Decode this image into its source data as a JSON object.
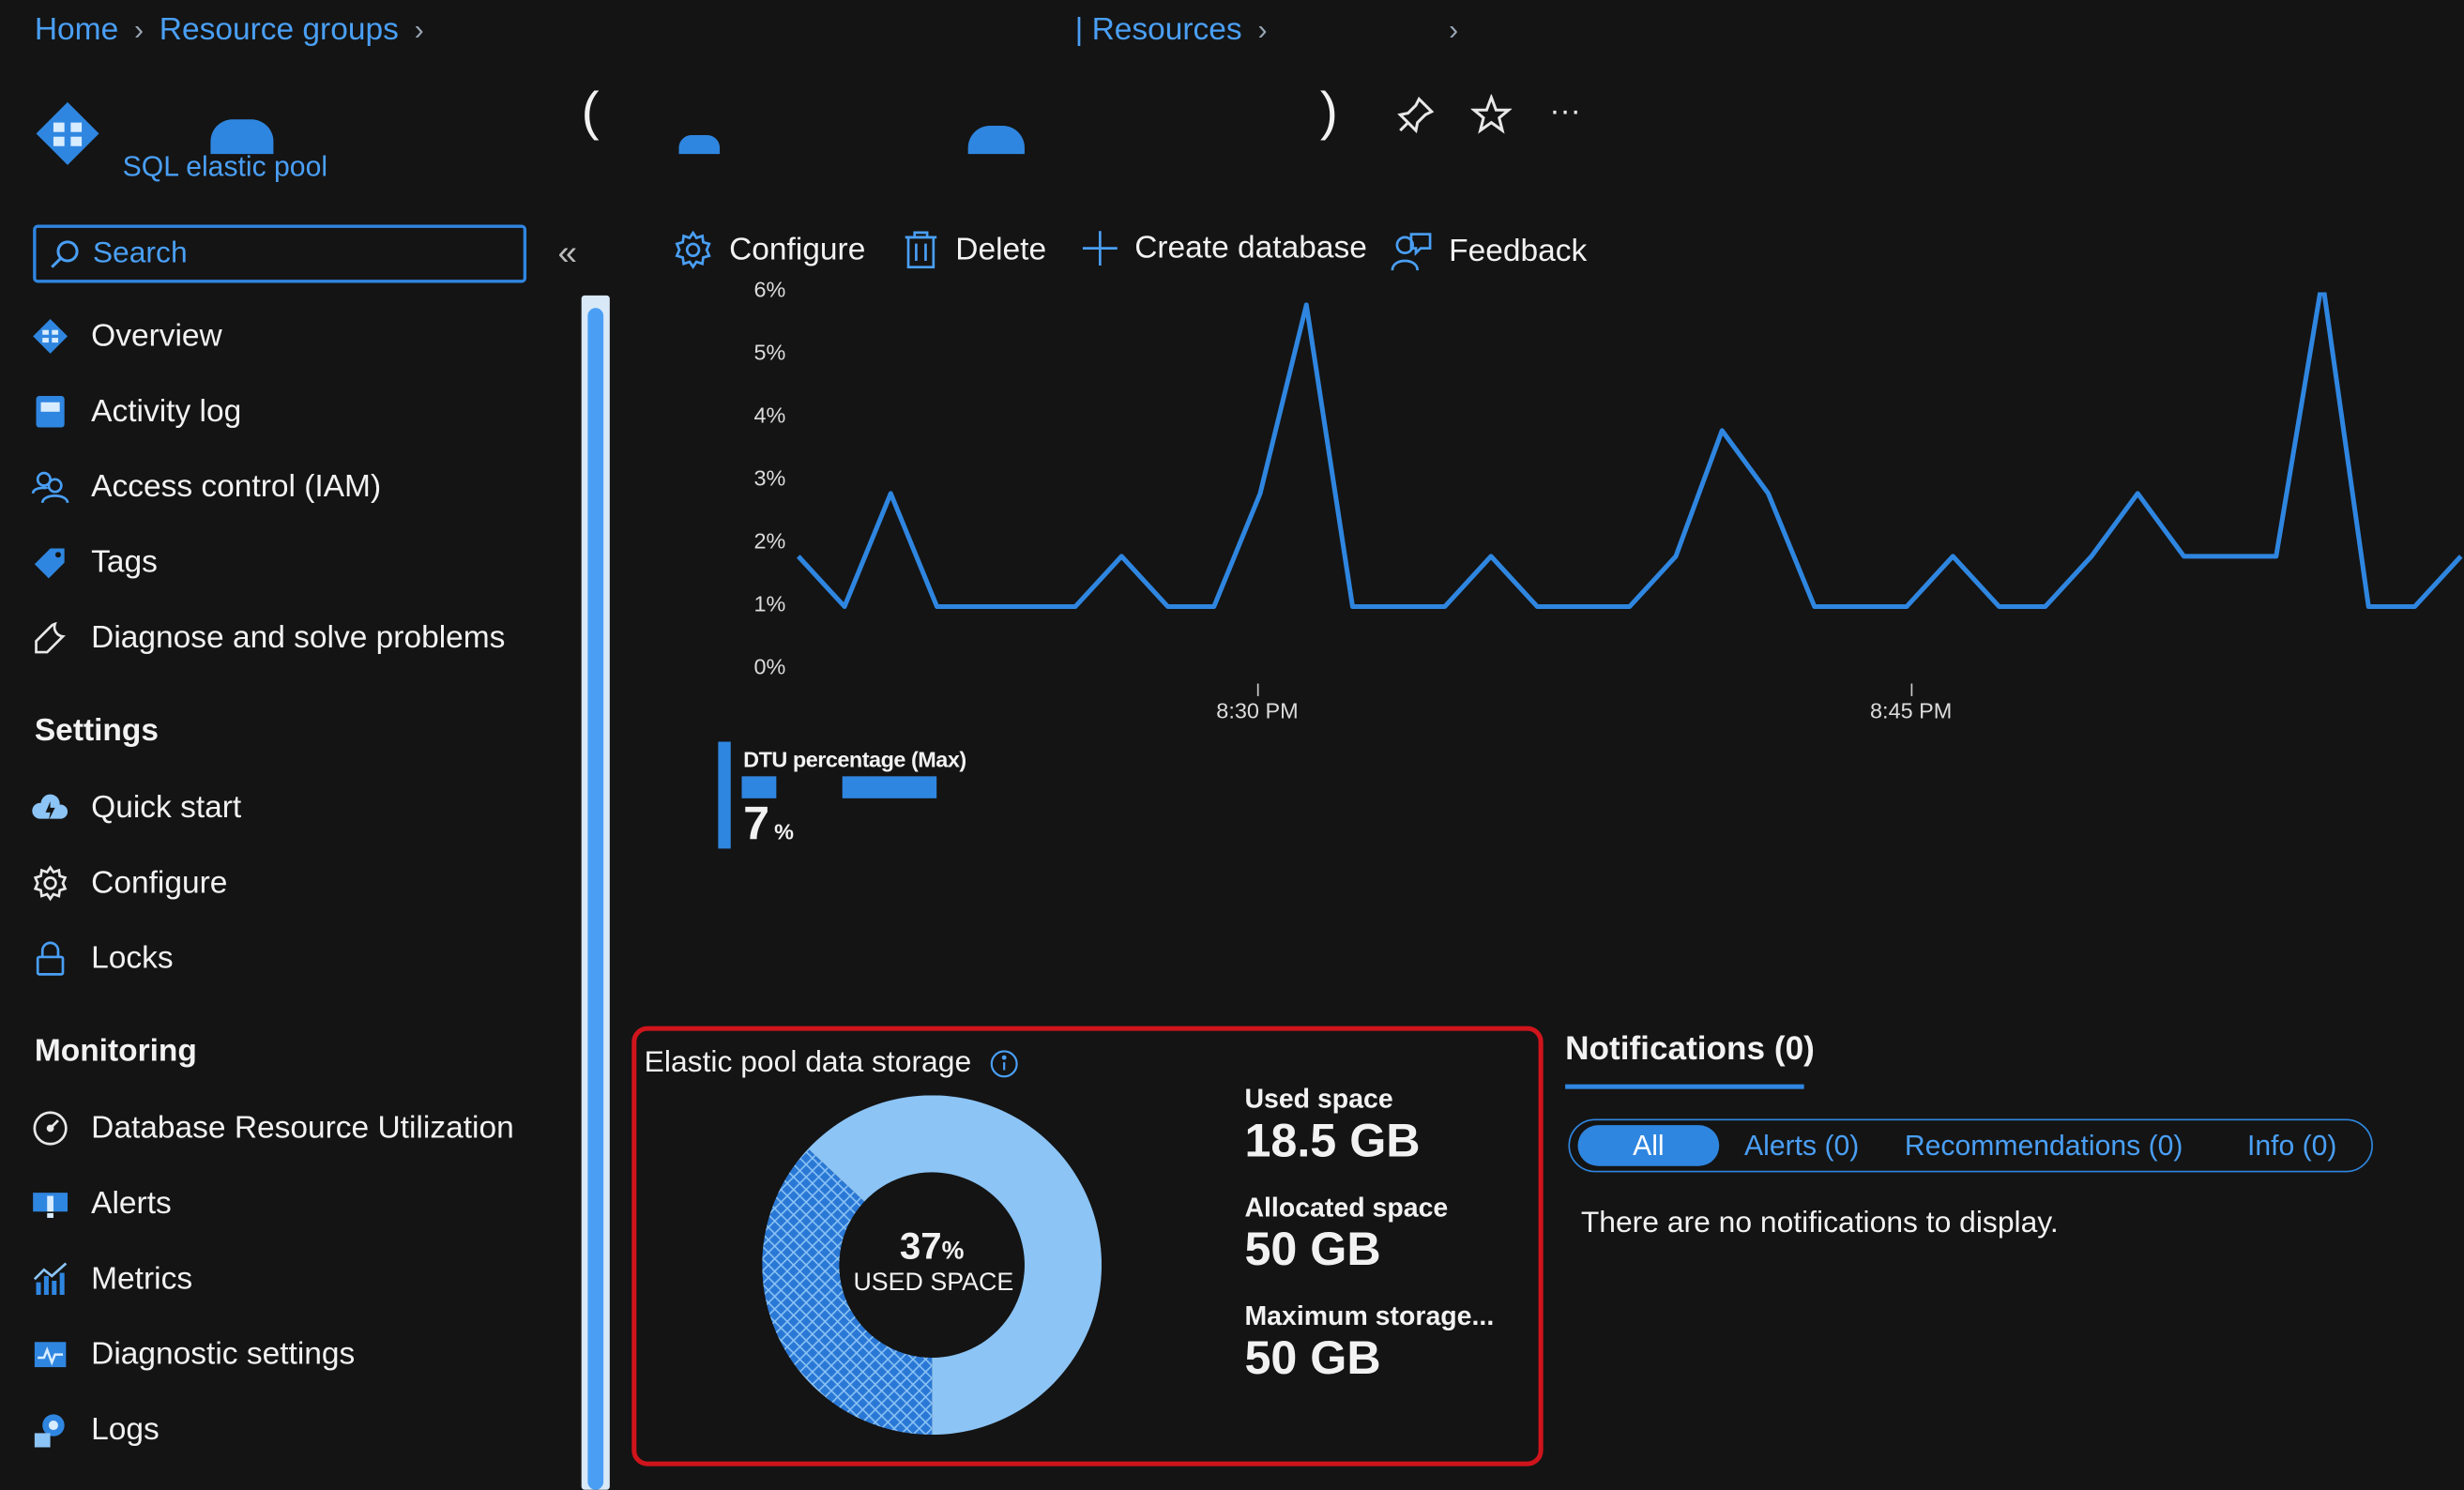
{
  "breadcrumb": {
    "items": [
      "Home",
      "Resource groups",
      "| Resources"
    ]
  },
  "resource": {
    "title_open": "(",
    "title_close": ")",
    "type_label": "SQL elastic pool"
  },
  "search": {
    "placeholder": "Search"
  },
  "sidebar": {
    "top_items": [
      {
        "label": "Overview",
        "icon": "sql-pool-icon"
      },
      {
        "label": "Activity log",
        "icon": "activity-log-icon"
      },
      {
        "label": "Access control (IAM)",
        "icon": "people-icon"
      },
      {
        "label": "Tags",
        "icon": "tag-icon"
      },
      {
        "label": "Diagnose and solve problems",
        "icon": "wrench-icon"
      }
    ],
    "settings_heading": "Settings",
    "settings_items": [
      {
        "label": "Quick start",
        "icon": "cloud-icon"
      },
      {
        "label": "Configure",
        "icon": "gear-icon"
      },
      {
        "label": "Locks",
        "icon": "lock-icon"
      }
    ],
    "monitoring_heading": "Monitoring",
    "monitoring_items": [
      {
        "label": "Database Resource Utilization",
        "icon": "gauge-icon"
      },
      {
        "label": "Alerts",
        "icon": "alert-icon"
      },
      {
        "label": "Metrics",
        "icon": "metrics-icon"
      },
      {
        "label": "Diagnostic settings",
        "icon": "diagnostic-icon"
      },
      {
        "label": "Logs",
        "icon": "logs-icon"
      }
    ]
  },
  "toolbar": {
    "configure": "Configure",
    "delete": "Delete",
    "create_database": "Create database",
    "feedback": "Feedback",
    "more": "···"
  },
  "chart_data": {
    "type": "line",
    "y_ticks": [
      "0%",
      "1%",
      "2%",
      "3%",
      "4%",
      "5%",
      "6%"
    ],
    "x_ticks": [
      "8:30 PM",
      "8:45 PM"
    ],
    "ylim": [
      0,
      6
    ],
    "series": [
      {
        "name": "DTU percentage (Max)",
        "color": "#2f86e0",
        "values": [
          1.8,
          1.0,
          2.8,
          1.0,
          1.0,
          1.0,
          1.0,
          1.8,
          1.0,
          1.0,
          2.8,
          5.8,
          1.0,
          1.0,
          1.0,
          1.8,
          1.0,
          1.0,
          1.0,
          1.8,
          3.8,
          2.8,
          1.0,
          1.0,
          1.0,
          1.8,
          1.0,
          1.0,
          1.8,
          2.8,
          1.8,
          1.8,
          1.8,
          6.2,
          1.0,
          1.0,
          1.8
        ]
      }
    ],
    "summary": {
      "label": "DTU percentage (Max)",
      "value": "7",
      "unit": "%"
    }
  },
  "storage": {
    "title": "Elastic pool data storage",
    "used_fraction": 0.37,
    "donut_percent": "37",
    "donut_percent_sign": "%",
    "donut_caption": "USED SPACE",
    "used_label": "Used space",
    "used_value": "18.5 GB",
    "allocated_label": "Allocated space",
    "allocated_value": "50 GB",
    "max_label": "Maximum storage...",
    "max_value": "50 GB"
  },
  "notifications": {
    "title": "Notifications (0)",
    "tabs": [
      "All",
      "Alerts (0)",
      "Recommendations (0)",
      "Info (0)"
    ],
    "empty_text": "There are no notifications to display."
  },
  "colors": {
    "accent": "#4a9ff5",
    "line": "#2f86e0",
    "highlight_border": "#d0141c",
    "donut_light": "#8cc4f5",
    "donut_hatch": "#2a78d6"
  }
}
